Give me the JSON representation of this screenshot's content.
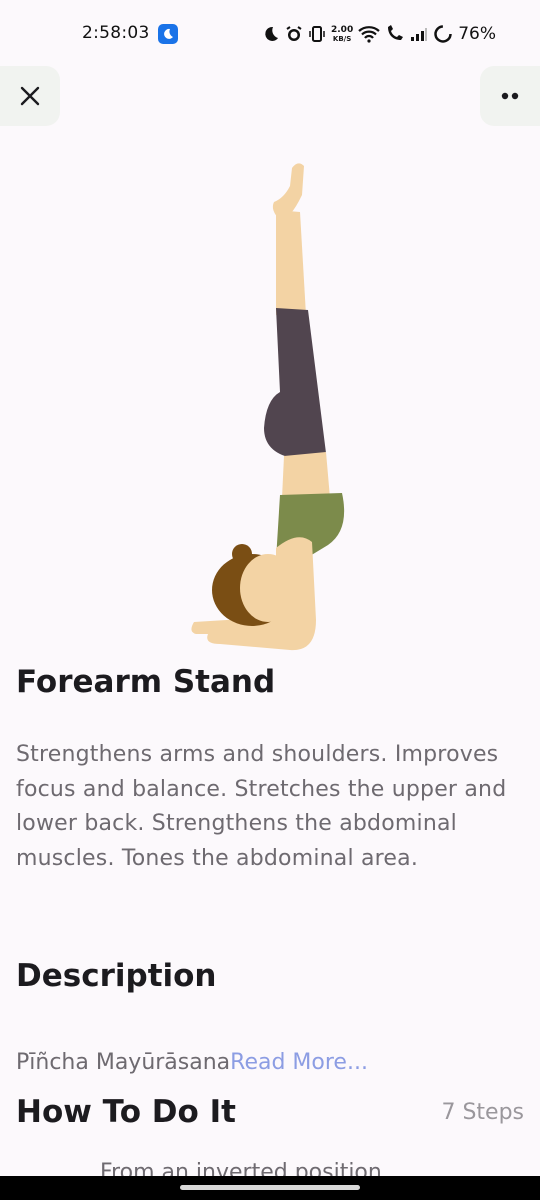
{
  "status": {
    "time": "2:58:03",
    "net_speed_value": "2.00",
    "net_speed_unit": "KB/S",
    "battery": "76%"
  },
  "pose": {
    "name": "Forearm Stand",
    "benefits": "Strengthens arms and shoulders.  Improves focus and balance.  Stretches the upper and lower back.  Strengthens the abdominal muscles.  Tones the abdominal area."
  },
  "description": {
    "title": "Description",
    "sanskrit": "Pīñcha Mayūrāsana",
    "read_more": "Read More..."
  },
  "how_to": {
    "title": "How To Do It",
    "steps_count": "7 Steps",
    "first_step_peek": "From an inverted position..."
  },
  "icons": {
    "close": "close-icon",
    "more": "more-dots-icon"
  },
  "colors": {
    "accent": "#8c9de3",
    "background": "#fcf9fc",
    "button_bg": "#f1f3f0"
  }
}
